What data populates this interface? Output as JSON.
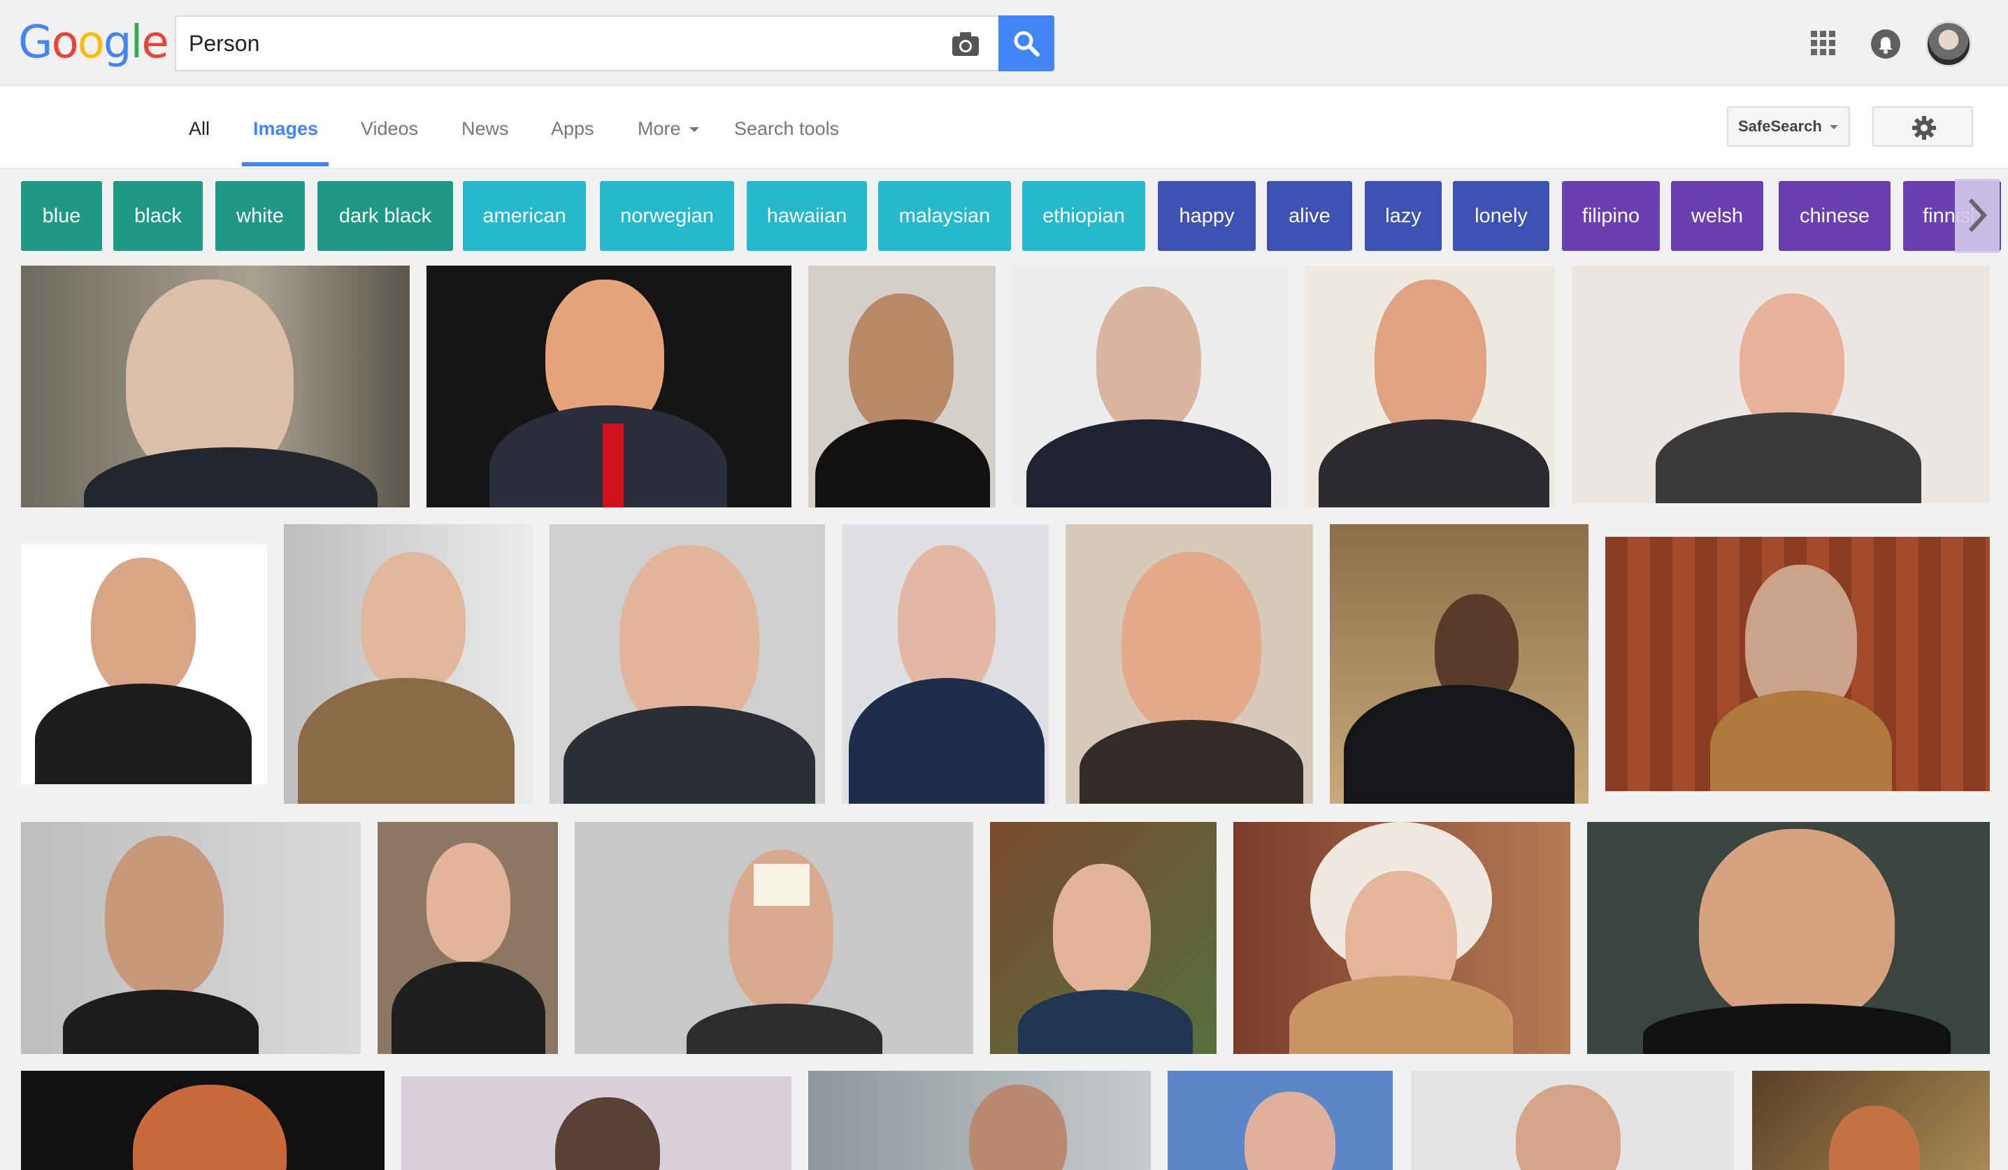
{
  "brand": "Google",
  "search": {
    "query": "Person"
  },
  "tabs": [
    {
      "label": "All"
    },
    {
      "label": "Images"
    },
    {
      "label": "Videos"
    },
    {
      "label": "News"
    },
    {
      "label": "Apps"
    },
    {
      "label": "More"
    },
    {
      "label": "Search tools"
    }
  ],
  "toolbar": {
    "safesearch_label": "SafeSearch"
  },
  "chips": [
    {
      "label": "blue"
    },
    {
      "label": "black"
    },
    {
      "label": "white"
    },
    {
      "label": "dark black"
    },
    {
      "label": "american"
    },
    {
      "label": "norwegian"
    },
    {
      "label": "hawaiian"
    },
    {
      "label": "malaysian"
    },
    {
      "label": "ethiopian"
    },
    {
      "label": "happy"
    },
    {
      "label": "alive"
    },
    {
      "label": "lazy"
    },
    {
      "label": "lonely"
    },
    {
      "label": "filipino"
    },
    {
      "label": "welsh"
    },
    {
      "label": "chinese"
    },
    {
      "label": "finnish"
    }
  ],
  "colors": {
    "accent": "#4285f4",
    "chip_green": "#1f9886",
    "chip_teal": "#26b8cd",
    "chip_blue": "#3e52b3",
    "chip_purple": "#6a3fb0"
  },
  "icons": [
    "camera-icon",
    "search-icon",
    "apps-grid-icon",
    "notifications-icon",
    "gear-icon",
    "chevron-right-icon",
    "dropdown-arrow-icon"
  ]
}
